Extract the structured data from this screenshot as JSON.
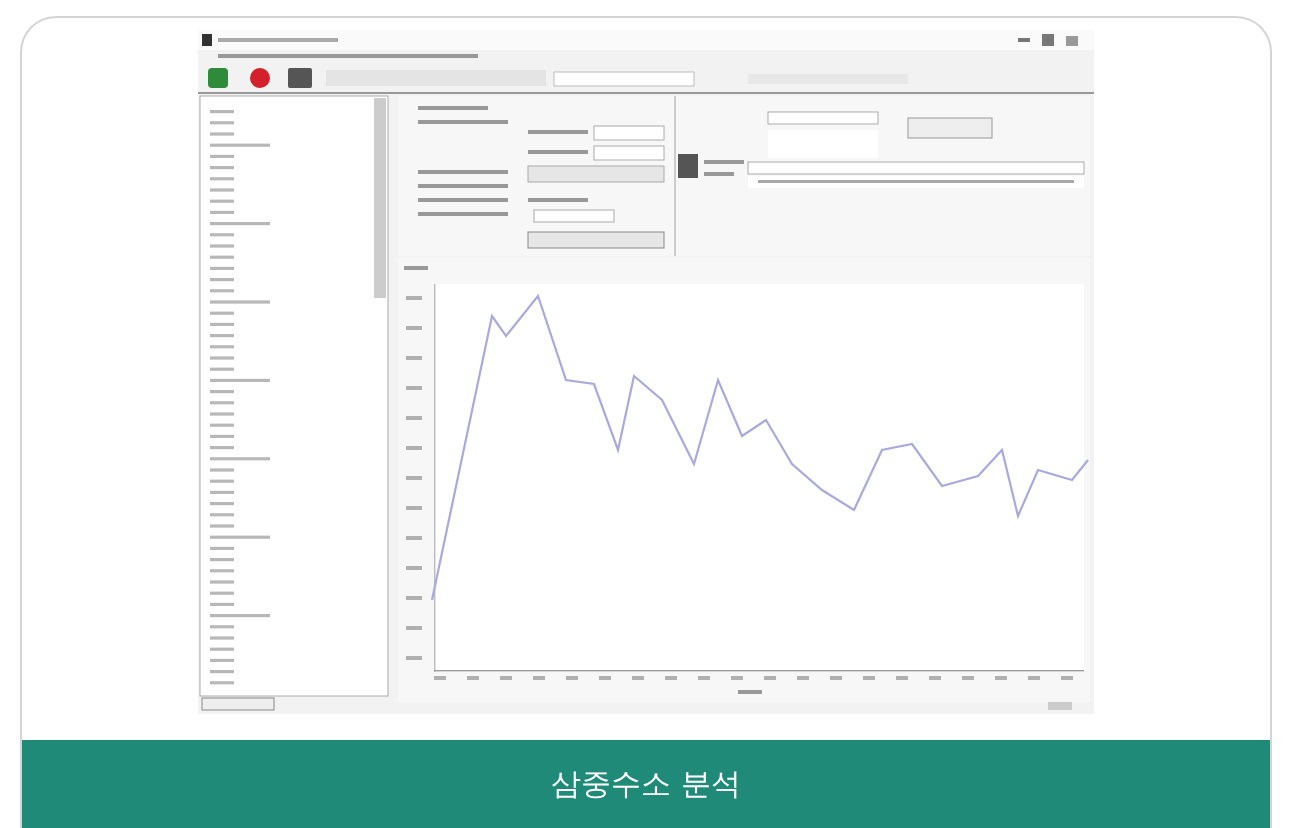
{
  "card": {
    "caption": "삼중수소 분석"
  }
}
